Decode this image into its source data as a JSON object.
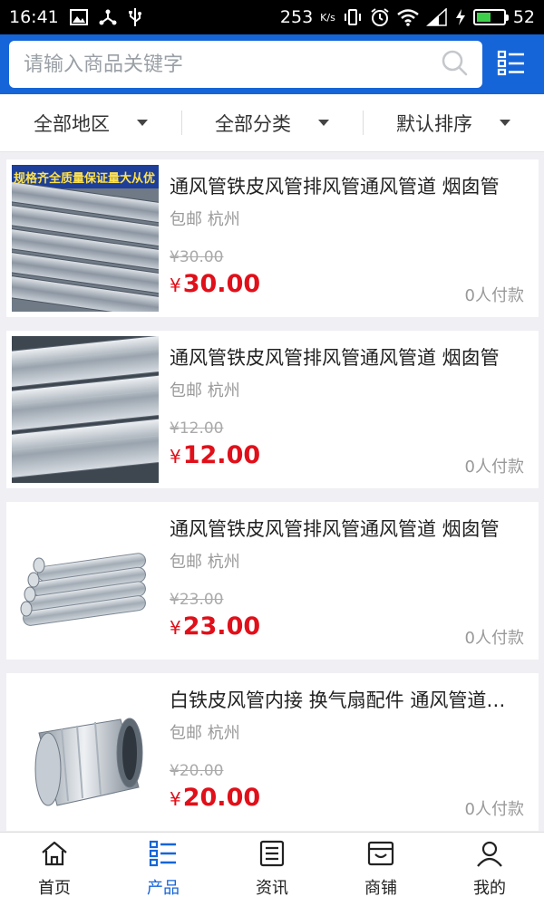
{
  "status_bar": {
    "time": "16:41",
    "net_speed": "253",
    "net_unit": "K/s",
    "battery": "52",
    "battery_level": 0.52
  },
  "search": {
    "placeholder": "请输入商品关键字"
  },
  "filters": [
    {
      "label": "全部地区"
    },
    {
      "label": "全部分类"
    },
    {
      "label": "默认排序"
    }
  ],
  "products": [
    {
      "title": "通风管铁皮风管排风管通风管道 烟囱管",
      "shipping": "包邮 杭州",
      "old_price": "¥30.00",
      "currency": "¥",
      "price": "30.00",
      "sold": "0人付款",
      "banner": "规格齐全质量保证量大从优"
    },
    {
      "title": "通风管铁皮风管排风管通风管道 烟囱管",
      "shipping": "包邮 杭州",
      "old_price": "¥12.00",
      "currency": "¥",
      "price": "12.00",
      "sold": "0人付款"
    },
    {
      "title": "通风管铁皮风管排风管通风管道 烟囱管",
      "shipping": "包邮 杭州",
      "old_price": "¥23.00",
      "currency": "¥",
      "price": "23.00",
      "sold": "0人付款"
    },
    {
      "title": "白铁皮风管内接 换气扇配件 通风管道连接件",
      "shipping": "包邮 杭州",
      "old_price": "¥20.00",
      "currency": "¥",
      "price": "20.00",
      "sold": "0人付款"
    }
  ],
  "tabs": [
    {
      "label": "首页",
      "icon": "home-icon"
    },
    {
      "label": "产品",
      "icon": "list-icon",
      "active": true
    },
    {
      "label": "资讯",
      "icon": "news-icon"
    },
    {
      "label": "商铺",
      "icon": "store-icon"
    },
    {
      "label": "我的",
      "icon": "user-icon"
    }
  ],
  "colors": {
    "brand": "#1565d8",
    "price": "#e0101a"
  }
}
